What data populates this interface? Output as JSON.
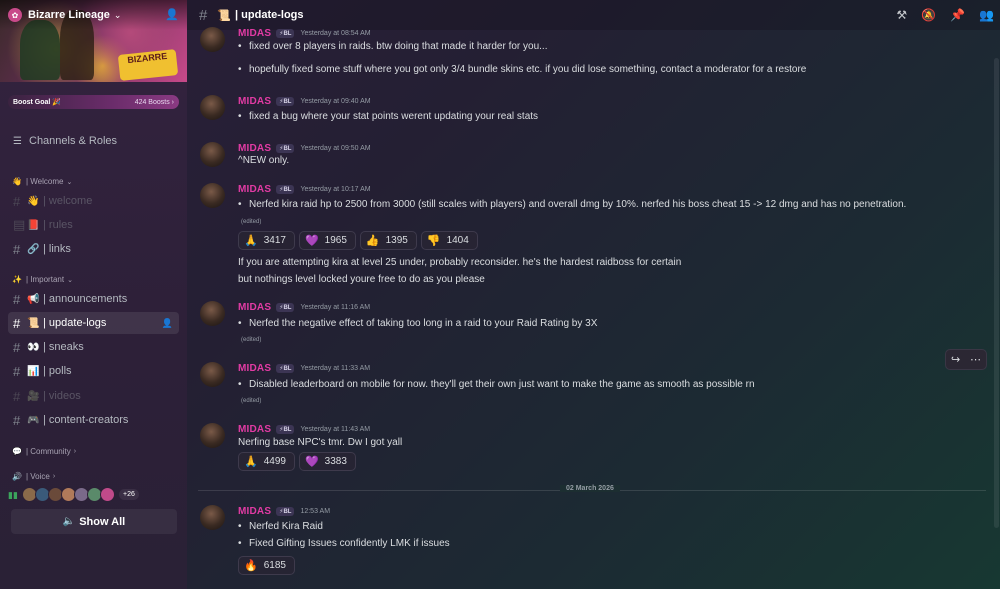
{
  "server": {
    "name": "Bizarre Lineage",
    "banner_text": "BIZARRE"
  },
  "boost": {
    "label": "Boost Goal 🎉",
    "count": "424 Boosts ›"
  },
  "sidebar": {
    "channels_roles": "Channels & Roles",
    "categories": {
      "welcome": "| Welcome",
      "important": "| Important",
      "community": "| Community",
      "voice": "| Voice"
    },
    "welcome_items": [
      {
        "label": "| welcome",
        "emoji": "👋"
      },
      {
        "label": "| rules",
        "emoji": "📕"
      },
      {
        "label": "| links",
        "emoji": "🔗"
      }
    ],
    "important_items": [
      {
        "label": "| announcements",
        "emoji": "📢"
      },
      {
        "label": "| update-logs",
        "emoji": "📜"
      },
      {
        "label": "| sneaks",
        "emoji": "👀"
      },
      {
        "label": "| polls",
        "emoji": "📊"
      },
      {
        "label": "| videos",
        "emoji": "🎥"
      },
      {
        "label": "| content-creators",
        "emoji": "🎮"
      }
    ],
    "voice_more": "+26",
    "show_all": "Show All"
  },
  "channel": {
    "name": "| update-logs",
    "emoji": "📜"
  },
  "author": {
    "name": "MIDAS",
    "tag": "⚡BL"
  },
  "messages": [
    {
      "ts": "Yesterday at 08:54 AM",
      "lines": [
        "fixed over 8 players in raids. btw doing that made it harder for you...",
        "hopefully fixed some stuff where you got only 3/4 bundle skins etc. if you did lose something, contact a moderator for a restore"
      ]
    },
    {
      "ts": "Yesterday at 09:40 AM",
      "lines": [
        "fixed a bug where your stat points werent updating your real stats"
      ]
    },
    {
      "ts": "Yesterday at 09:50 AM",
      "lines": [
        "^NEW only."
      ]
    },
    {
      "ts": "Yesterday at 10:17 AM",
      "lines": [
        "Nerfed kira raid hp to 2500 from 3000 (still scales with players) and overall dmg by 10%. nerfed his boss cheat 15 -> 12 dmg and has no penetration."
      ],
      "edited": "(edited)",
      "reactions": [
        {
          "emoji": "🙏",
          "count": "3417"
        },
        {
          "emoji": "💜",
          "count": "1965"
        },
        {
          "emoji": "👍",
          "count": "1395"
        },
        {
          "emoji": "👎",
          "count": "1404"
        }
      ],
      "followups": [
        "If you are attempting kira at level 25 under, probably reconsider. he's the hardest raidboss for certain",
        "but nothings level locked youre free to do as you please"
      ]
    },
    {
      "ts": "Yesterday at 11:16 AM",
      "lines": [
        "Nerfed the negative effect of taking too long in a raid to your Raid Rating by 3X"
      ],
      "edited": "(edited)"
    },
    {
      "ts": "Yesterday at 11:33 AM",
      "lines": [
        "Disabled leaderboard on mobile for now. they'll get their own just want to make the game as smooth as possible rn"
      ],
      "edited": "(edited)"
    },
    {
      "ts": "Yesterday at 11:43 AM",
      "lines": [
        "Nerfing base NPC's tmr. Dw I got yall"
      ],
      "reactions": [
        {
          "emoji": "🙏",
          "count": "4499"
        },
        {
          "emoji": "💜",
          "count": "3383"
        }
      ]
    },
    {
      "ts": "12:53 AM",
      "lines": [
        "Nerfed Kira Raid",
        "Fixed Gifting Issues confidently LMK if issues"
      ],
      "reactions": [
        {
          "emoji": "🔥",
          "count": "6185"
        }
      ]
    }
  ],
  "date_divider": "02 March 2026",
  "colors": {
    "username": "#e23ba4",
    "accent": "#5865f2"
  }
}
